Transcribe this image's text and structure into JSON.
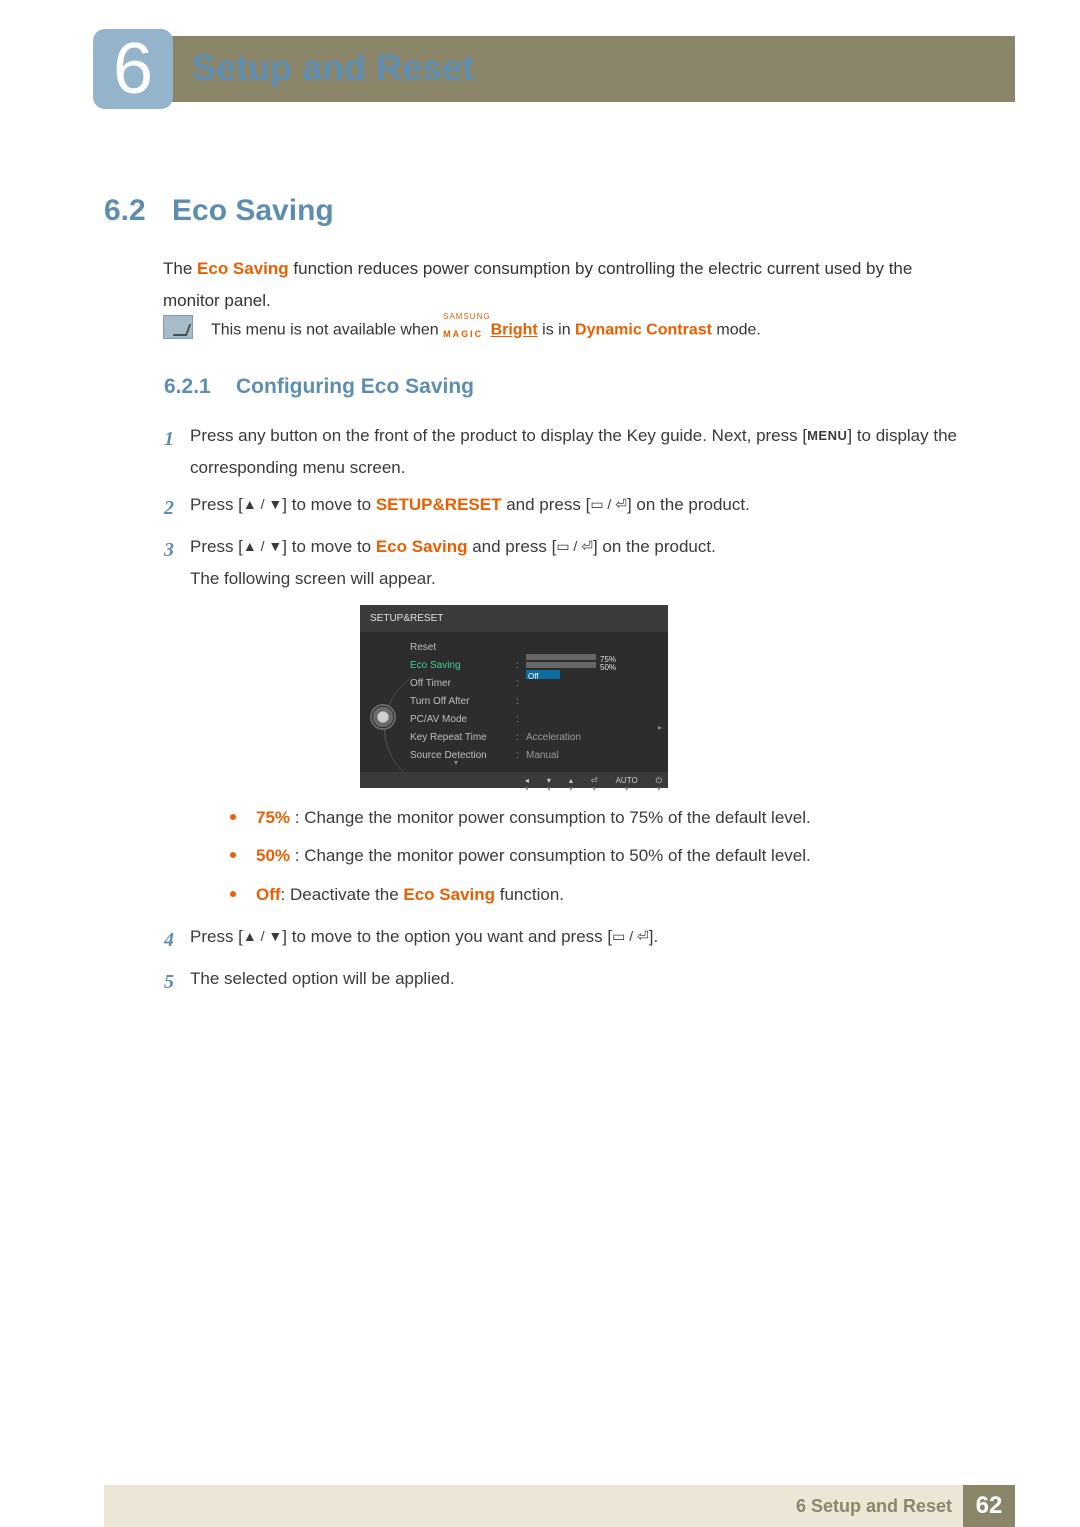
{
  "chapter": {
    "number": "6",
    "title": "Setup and Reset"
  },
  "section": {
    "number": "6.2",
    "title": "Eco Saving"
  },
  "intro": {
    "prefix": "The ",
    "feature": "Eco Saving",
    "suffix": " function reduces power consumption by controlling the electric current used by the monitor panel."
  },
  "note": {
    "prefix": "This menu is not available when ",
    "magic_samsung": "SAMSUNG",
    "magic_magic": "MAGIC",
    "magic_bright": "Bright",
    "middle": " is in ",
    "dynamic_contrast": "Dynamic Contrast",
    "suffix": " mode."
  },
  "subsection": {
    "number": "6.2.1",
    "title": "Configuring Eco Saving"
  },
  "steps": {
    "s1": {
      "num": "1",
      "t1": "Press any button on the front of the product to display the Key guide. Next, press [",
      "menu": "MENU",
      "t2": "] to display the corresponding menu screen."
    },
    "s2": {
      "num": "2",
      "t1": "Press [",
      "arrows": "▲ / ▼",
      "t2": "] to move to ",
      "kw": "SETUP&RESET",
      "t3": " and press [",
      "enter": "▭ / ⏎",
      "t4": "] on the product."
    },
    "s3": {
      "num": "3",
      "t1": "Press [",
      "arrows": "▲ / ▼",
      "t2": "] to move to ",
      "kw": "Eco Saving",
      "t3": " and press [",
      "enter": "▭ / ⏎",
      "t4": "] on the product.",
      "following": "The following screen will appear."
    },
    "s4": {
      "num": "4",
      "t1": "Press [",
      "arrows": "▲ / ▼",
      "t2": "] to move to the option you want and press [",
      "enter": "▭ / ⏎",
      "t3": "]."
    },
    "s5": {
      "num": "5",
      "t1": "The selected option will be applied."
    }
  },
  "bullets": {
    "b1": {
      "kw": "75%",
      "text": " : Change the monitor power consumption to 75% of the default level."
    },
    "b2": {
      "kw": "50%",
      "text": " : Change the monitor power consumption to 50% of the default level."
    },
    "b3": {
      "kw": "Off",
      "mid": ": Deactivate the ",
      "kw2": "Eco Saving",
      "suffix": " function."
    }
  },
  "osd": {
    "title": "SETUP&RESET",
    "rows": {
      "reset": "Reset",
      "eco": "Eco Saving",
      "offtimer": "Off Timer",
      "turnoff": "Turn Off After",
      "pcav": "PC/AV Mode",
      "keyrep": "Key Repeat Time",
      "srcdet": "Source Detection"
    },
    "vals": {
      "keyrep": "Acceleration",
      "srcdet": "Manual"
    },
    "bars": {
      "p75": "75%",
      "p50": "50%",
      "off": "Off"
    },
    "footer": {
      "back": "◂",
      "down": "▾",
      "up": "▴",
      "enter": "⏎",
      "auto": "AUTO",
      "power": "⏻"
    }
  },
  "footer": {
    "chapter_line": "6 Setup and Reset",
    "page": "62"
  }
}
